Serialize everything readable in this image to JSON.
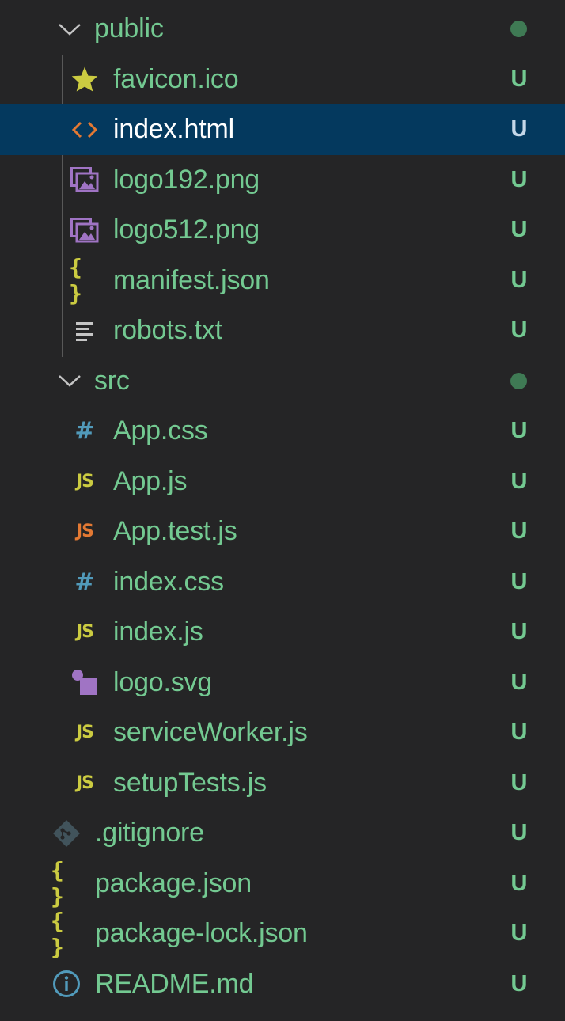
{
  "explorer": {
    "items": [
      {
        "name": "public",
        "kind": "folder",
        "icon": "chevron-down-icon",
        "status_dot": true
      },
      {
        "name": "favicon.ico",
        "kind": "file",
        "icon": "star-icon",
        "status": "U"
      },
      {
        "name": "index.html",
        "kind": "file",
        "icon": "html-icon",
        "status": "U",
        "selected": true
      },
      {
        "name": "logo192.png",
        "kind": "file",
        "icon": "image-icon",
        "status": "U"
      },
      {
        "name": "logo512.png",
        "kind": "file",
        "icon": "image-icon",
        "status": "U"
      },
      {
        "name": "manifest.json",
        "kind": "file",
        "icon": "json-icon",
        "status": "U"
      },
      {
        "name": "robots.txt",
        "kind": "file",
        "icon": "text-file-icon",
        "status": "U"
      },
      {
        "name": "src",
        "kind": "folder",
        "icon": "chevron-down-icon",
        "status_dot": true
      },
      {
        "name": "App.css",
        "kind": "file",
        "icon": "css-icon",
        "status": "U"
      },
      {
        "name": "App.js",
        "kind": "file",
        "icon": "javascript-icon",
        "status": "U"
      },
      {
        "name": "App.test.js",
        "kind": "file",
        "icon": "javascript-test-icon",
        "status": "U"
      },
      {
        "name": "index.css",
        "kind": "file",
        "icon": "css-icon",
        "status": "U"
      },
      {
        "name": "index.js",
        "kind": "file",
        "icon": "javascript-icon",
        "status": "U"
      },
      {
        "name": "logo.svg",
        "kind": "file",
        "icon": "svg-icon",
        "status": "U"
      },
      {
        "name": "serviceWorker.js",
        "kind": "file",
        "icon": "javascript-icon",
        "status": "U"
      },
      {
        "name": "setupTests.js",
        "kind": "file",
        "icon": "javascript-icon",
        "status": "U"
      },
      {
        "name": ".gitignore",
        "kind": "file",
        "icon": "git-icon",
        "status": "U"
      },
      {
        "name": "package.json",
        "kind": "file",
        "icon": "json-icon",
        "status": "U"
      },
      {
        "name": "package-lock.json",
        "kind": "file",
        "icon": "json-icon",
        "status": "U"
      },
      {
        "name": "README.md",
        "kind": "file",
        "icon": "info-icon",
        "status": "U"
      }
    ],
    "icon_glyphs": {
      "javascript": "JS",
      "css": "#",
      "json": "{ }"
    },
    "colors": {
      "background": "#252526",
      "selected_row": "#04395e",
      "untracked_text": "#73c991",
      "status_dot": "#3f7a54",
      "javascript": "#cbcb41",
      "javascript_test": "#e37933",
      "css": "#519aba",
      "html": "#e37933",
      "image": "#a074c4",
      "git": "#41535b"
    }
  }
}
